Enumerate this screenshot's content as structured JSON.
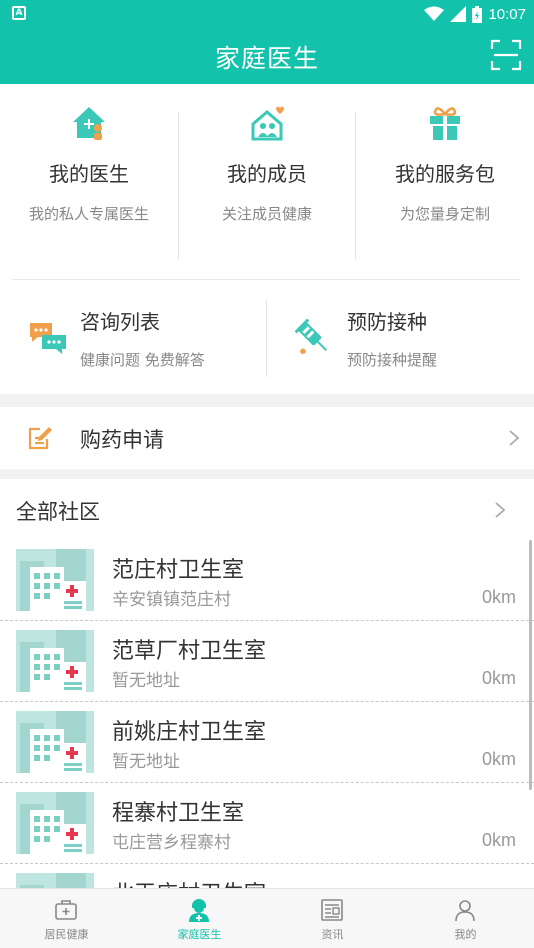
{
  "status_bar": {
    "time": "10:07",
    "app_badge": "A"
  },
  "app_bar": {
    "title": "家庭医生"
  },
  "services": [
    {
      "title": "我的医生",
      "subtitle": "我的私人专属医生",
      "icon": "doctor-house-icon"
    },
    {
      "title": "我的成员",
      "subtitle": "关注成员健康",
      "icon": "family-members-icon"
    },
    {
      "title": "我的服务包",
      "subtitle": "为您量身定制",
      "icon": "gift-package-icon"
    }
  ],
  "services2": [
    {
      "title": "咨询列表",
      "subtitle": "健康问题 免费解答",
      "icon": "chat-bubbles-icon"
    },
    {
      "title": "预防接种",
      "subtitle": "预防接种提醒",
      "icon": "syringe-icon"
    }
  ],
  "medicine_row": {
    "label": "购药申请",
    "icon": "edit-note-icon"
  },
  "community_header": {
    "label": "全部社区"
  },
  "clinics": [
    {
      "name": "范庄村卫生室",
      "address": "辛安镇镇范庄村",
      "distance": "0km"
    },
    {
      "name": "范草厂村卫生室",
      "address": "暂无地址",
      "distance": "0km"
    },
    {
      "name": "前姚庄村卫生室",
      "address": "暂无地址",
      "distance": "0km"
    },
    {
      "name": "程寨村卫生室",
      "address": "屯庄营乡程寨村",
      "distance": "0km"
    },
    {
      "name": "北王庄村卫生室",
      "address": "",
      "distance": ""
    }
  ],
  "tabs": [
    {
      "label": "居民健康",
      "icon": "medical-kit-icon",
      "active": false
    },
    {
      "label": "家庭医生",
      "icon": "doctor-avatar-icon",
      "active": true
    },
    {
      "label": "资讯",
      "icon": "news-icon",
      "active": false
    },
    {
      "label": "我的",
      "icon": "person-icon",
      "active": false
    }
  ],
  "colors": {
    "accent": "#12c2ab",
    "orange": "#f0a04b"
  }
}
